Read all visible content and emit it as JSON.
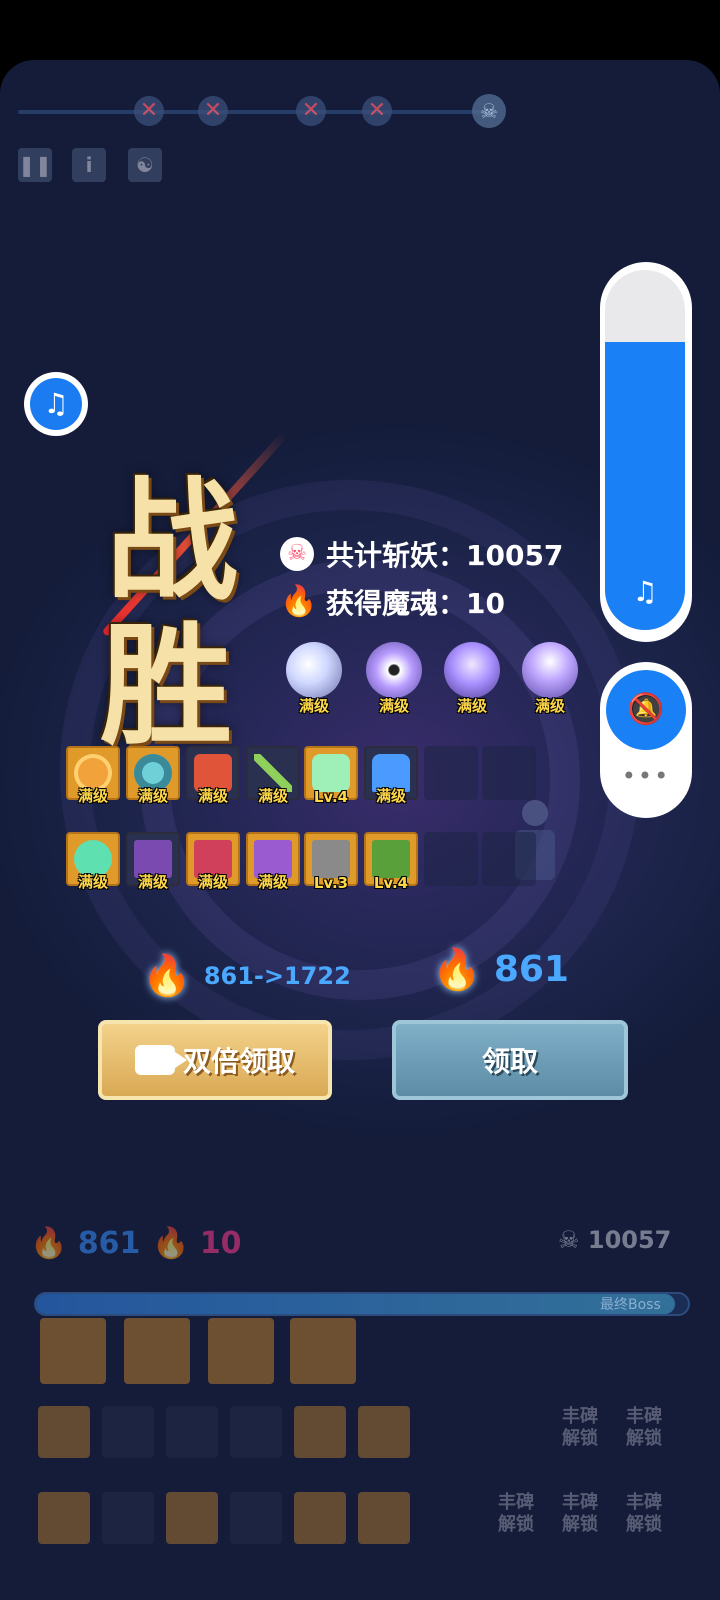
{
  "victory": {
    "char1": "战",
    "char2": "胜"
  },
  "stats": [
    {
      "icon": "skull-icon",
      "label": "共计斩妖：10057",
      "color": "#ff5070"
    },
    {
      "icon": "flame-icon",
      "label": "获得魔魂：10",
      "color": "#ff3a8a"
    }
  ],
  "orbs": [
    {
      "name": "orb-moon",
      "level": "满级",
      "color": "#cfd8ff"
    },
    {
      "name": "orb-vortex",
      "level": "满级",
      "color": "#b89cff"
    },
    {
      "name": "orb-wind",
      "level": "满级",
      "color": "#a990ff"
    },
    {
      "name": "orb-shield",
      "level": "满级",
      "color": "#c0a8ff"
    }
  ],
  "items_row1": [
    {
      "name": "item-lotus",
      "level": "满级",
      "color": "#f2a23a",
      "bg": "#e09a2a"
    },
    {
      "name": "item-ring",
      "level": "满级",
      "color": "#6fd0d8",
      "bg": "#e09a2a"
    },
    {
      "name": "item-guardian",
      "level": "满级",
      "color": "#e0553a",
      "bg": "#2a3050"
    },
    {
      "name": "item-spear",
      "level": "满级",
      "color": "#8fd05a",
      "bg": "#2a3050"
    },
    {
      "name": "item-jade",
      "level": "Lv.4",
      "color": "#9ff0b8",
      "bg": "#e09a2a"
    },
    {
      "name": "item-sage",
      "level": "满级",
      "color": "#4a9aff",
      "bg": "#2a3050"
    }
  ],
  "items_row2": [
    {
      "name": "item-pillow",
      "level": "满级",
      "color": "#5fe0b0",
      "bg": "#e09a2a"
    },
    {
      "name": "item-book-purple",
      "level": "满级",
      "color": "#7a4ab0",
      "bg": "#2a3050"
    },
    {
      "name": "item-book-red",
      "level": "满级",
      "color": "#d0405a",
      "bg": "#e09a2a"
    },
    {
      "name": "item-book-violet",
      "level": "满级",
      "color": "#9a5ad0",
      "bg": "#e09a2a"
    },
    {
      "name": "item-book-grey",
      "level": "Lv.3",
      "color": "#8a8a8a",
      "bg": "#e09a2a"
    },
    {
      "name": "item-book-green",
      "level": "Lv.4",
      "color": "#5aa03a",
      "bg": "#e09a2a"
    }
  ],
  "reward": {
    "double_value": "861->1722",
    "normal_value": "861"
  },
  "buttons": {
    "double_claim": "双倍领取",
    "claim": "领取"
  },
  "hud": {
    "souls_blue": "861",
    "souls_pink": "10",
    "kills": "10057",
    "bar_label": "最终Boss",
    "bar_fill": 0.98
  },
  "locked_label": "丰碑\n解锁",
  "locked_lines": [
    "丰碑",
    "解锁"
  ],
  "volume": {
    "level": 0.8
  }
}
